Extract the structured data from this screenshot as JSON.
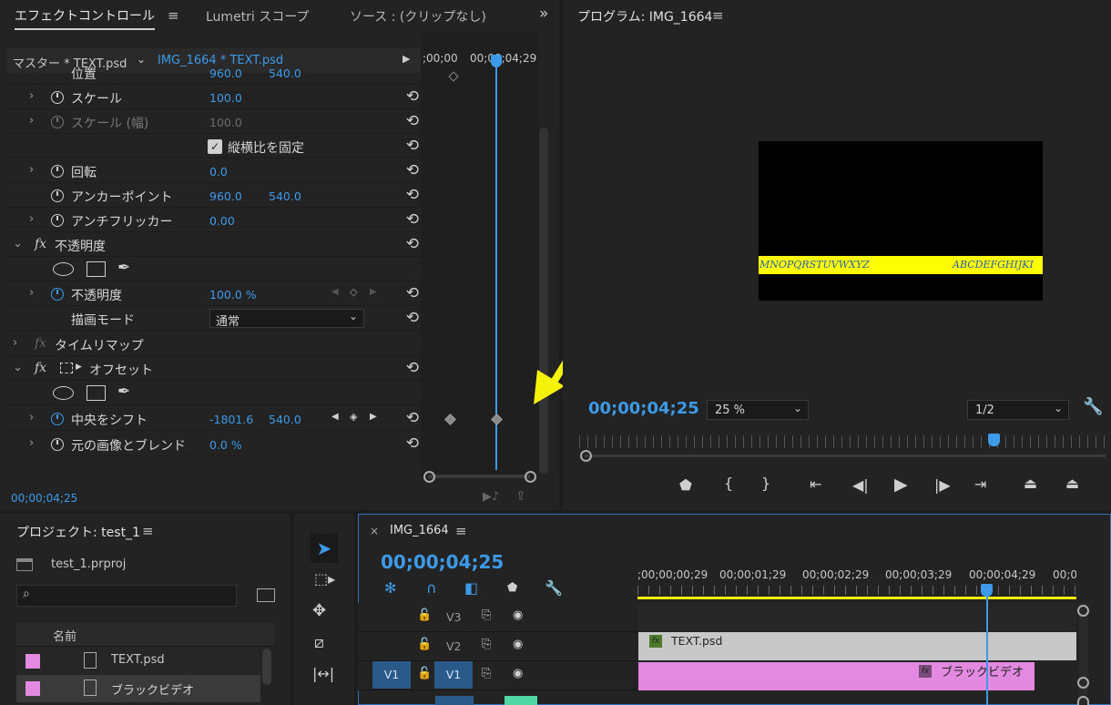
{
  "effect_controls": {
    "tabs": [
      "エフェクトコントロール",
      "Lumetri スコープ",
      "ソース : (クリップなし)"
    ],
    "master_label": "マスター * TEXT.psd",
    "clip_label": "IMG_1664 * TEXT.psd",
    "time_start": ";00;00",
    "time_playhead": "00;00;04;29",
    "rows": {
      "position": {
        "label": "位置",
        "v1": "960.0",
        "v2": "540.0"
      },
      "scale": {
        "label": "スケール",
        "v1": "100.0"
      },
      "scale_width": {
        "label": "スケール (幅)",
        "v1": "100.0"
      },
      "uniform": {
        "label": "縦横比を固定"
      },
      "rotation": {
        "label": "回転",
        "v1": "0.0"
      },
      "anchor": {
        "label": "アンカーポイント",
        "v1": "960.0",
        "v2": "540.0"
      },
      "antiflicker": {
        "label": "アンチフリッカー",
        "v1": "0.00"
      },
      "opacity_group": {
        "label": "不透明度"
      },
      "opacity": {
        "label": "不透明度",
        "v1": "100.0 %"
      },
      "blend": {
        "label": "描画モード",
        "value": "通常"
      },
      "time_remap": {
        "label": "タイムリマップ"
      },
      "offset_group": {
        "label": "オフセット"
      },
      "shift_center": {
        "label": "中央をシフト",
        "v1": "-1801.6",
        "v2": "540.0"
      },
      "blend_original": {
        "label": "元の画像とブレンド",
        "v1": "0.0 %"
      }
    },
    "current_time": "00;00;04;25"
  },
  "program": {
    "title": "プログラム: IMG_1664",
    "timecode": "00;00;04;25",
    "zoom": "25 %",
    "resolution": "1/2",
    "preview_text_left": "MNOPQRSTUVWXYZ",
    "preview_text_right": "ABCDEFGHIJKI"
  },
  "project": {
    "title": "プロジェクト: test_1",
    "file": "test_1.prproj",
    "column_name": "名前",
    "items": [
      "TEXT.psd",
      "ブラックビデオ"
    ]
  },
  "timeline": {
    "tab": "IMG_1664",
    "timecode": "00;00;04;25",
    "ticks": [
      ";00;00;00;29",
      "00;00;01;29",
      "00;00;02;29",
      "00;00;03;29",
      "00;00;04;29",
      "00;0"
    ],
    "tracks": [
      "V3",
      "V2",
      "V1"
    ],
    "source_patch": "V1",
    "clip_text": "TEXT.psd",
    "clip_black": "ブラックビデオ"
  },
  "colors": {
    "accent": "#3d9ae8",
    "clip_pink": "#e38ae0",
    "clip_gray": "#c8c8c8",
    "arrow": "#f5f20a"
  }
}
